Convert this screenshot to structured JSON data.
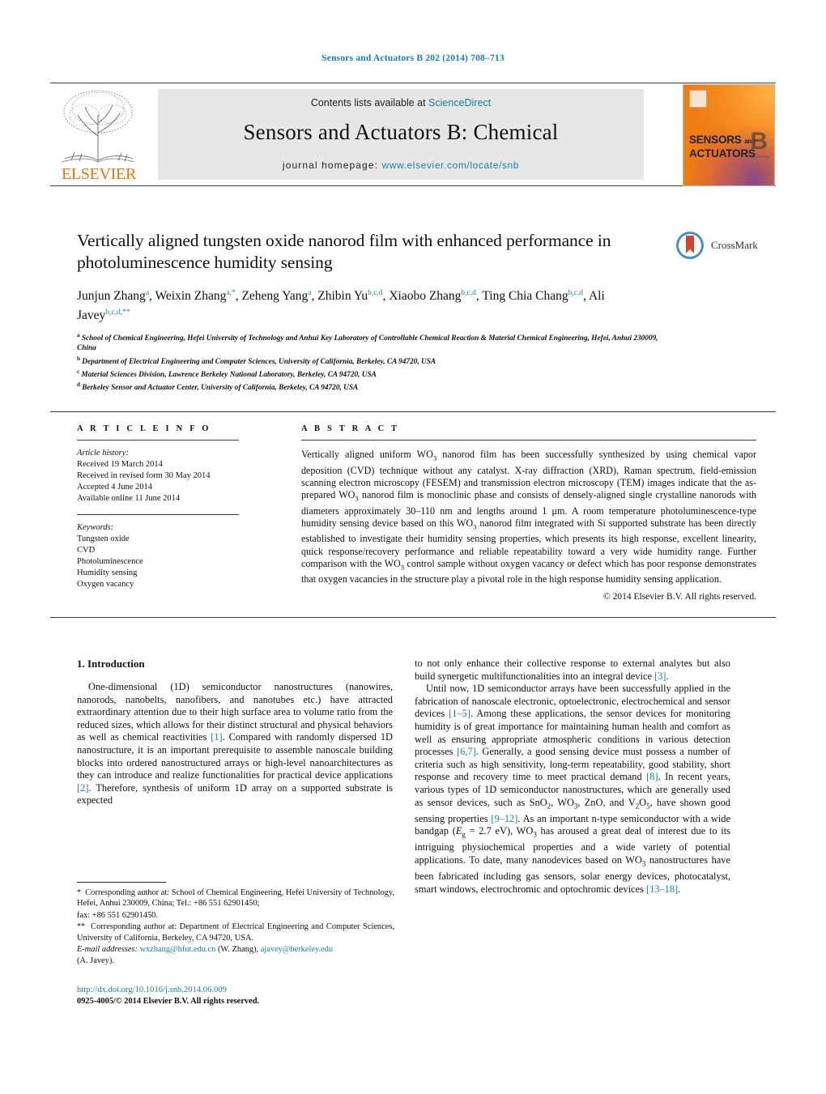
{
  "running_head": "Sensors and Actuators B 202 (2014) 708–713",
  "masthead": {
    "contents_prefix": "Contents lists available at ",
    "sciencedirect": "ScienceDirect",
    "journal_title": "Sensors and Actuators B: Chemical",
    "homepage_label": "journal homepage:",
    "homepage_url": "www.elsevier.com/locate/snb",
    "publisher_wordmark": "ELSEVIER",
    "cover": {
      "line1": "SENSORS",
      "line1_small": "and",
      "line2": "ACTUATORS",
      "volume_letter": "B",
      "volume_sub": "Chemical"
    }
  },
  "article": {
    "title": "Vertically aligned tungsten oxide nanorod film with enhanced performance in photoluminescence humidity sensing",
    "authors_html": "Junjun Zhang<sup>a</sup>, Weixin Zhang<sup>a,*</sup>, Zeheng Yang<sup>a</sup>, Zhibin Yu<sup>b,c,d</sup>, Xiaobo Zhang<sup>b,c,d</sup>, Ting Chia Chang<sup>b,c,d</sup>, Ali Javey<sup>b,c,d,**</sup>",
    "crossmark_label": "CrossMark",
    "affiliations": [
      "a School of Chemical Engineering, Hefei University of Technology and Anhui Key Laboratory of Controllable Chemical Reaction & Material Chemical Engineering, Hefei, Anhui 230009, China",
      "b Department of Electrical Engineering and Computer Sciences, University of California, Berkeley, CA 94720, USA",
      "c Material Sciences Division, Lawrence Berkeley National Laboratory, Berkeley, CA 94720, USA",
      "d Berkeley Sensor and Actuator Center, University of California, Berkeley, CA 94720, USA"
    ]
  },
  "article_info": {
    "heading": "A R T I C L E   I N F O",
    "history_label": "Article history:",
    "history": [
      "Received 19 March 2014",
      "Received in revised form 30 May 2014",
      "Accepted 4 June 2014",
      "Available online 11 June 2014"
    ],
    "keywords_label": "Keywords:",
    "keywords": [
      "Tungsten oxide",
      "CVD",
      "Photoluminescence",
      "Humidity sensing",
      "Oxygen vacancy"
    ]
  },
  "abstract": {
    "heading": "A B S T R A C T",
    "text_html": "Vertically aligned uniform WO<sub>3</sub> nanorod film has been successfully synthesized by using chemical vapor deposition (CVD) technique without any catalyst. X-ray diffraction (XRD), Raman spectrum, field-emission scanning electron microscopy (FESEM) and transmission electron microscopy (TEM) images indicate that the as-prepared WO<sub>3</sub> nanorod film is monoclinic phase and consists of densely-aligned single crystalline nanorods with diameters approximately 30–110 nm and lengths around 1 μm. A room temperature photoluminescence-type humidity sensing device based on this WO<sub>3</sub> nanorod film integrated with Si supported substrate has been directly established to investigate their humidity sensing properties, which presents its high response, excellent linearity, quick response/recovery performance and reliable repeatability toward a very wide humidity range. Further comparison with the WO<sub>3</sub> control sample without oxygen vacancy or defect which has poor response demonstrates that oxygen vacancies in the structure play a pivotal role in the high response humidity sensing application.",
    "copyright": "© 2014 Elsevier B.V. All rights reserved."
  },
  "body": {
    "section_heading": "1.  Introduction",
    "left_paragraphs_html": [
      "One-dimensional (1D) semiconductor nanostructures (nanowires, nanorods, nanobelts, nanofibers, and nanotubes etc.) have attracted extraordinary attention due to their high surface area to volume ratio from the reduced sizes, which allows for their distinct structural and physical behaviors as well as chemical reactivities <span class=\"cite\">[1]</span>. Compared with randomly dispersed 1D nanostructure, it is an important prerequisite to assemble nanoscale building blocks into ordered nanostructured arrays or high-level nanoarchitectures as they can introduce and realize functionalities for practical device applications <span class=\"cite\">[2]</span>. Therefore, synthesis of uniform 1D array on a supported substrate is expected"
    ],
    "right_paragraphs_html": [
      "to not only enhance their collective response to external analytes but also build synergetic multifunctionalities into an integral device <span class=\"cite\">[3]</span>.",
      "Until now, 1D semiconductor arrays have been successfully applied in the fabrication of nanoscale electronic, optoelectronic, electrochemical and sensor devices <span class=\"cite\">[1–5]</span>. Among these applications, the sensor devices for monitoring humidity is of great importance for maintaining human health and comfort as well as ensuring appropriate atmospheric conditions in various detection processes <span class=\"cite\">[6,7]</span>. Generally, a good sensing device must possess a number of criteria such as high sensitivity, long-term repeatability, good stability, short response and recovery time to meet practical demand <span class=\"cite\">[8]</span>. In recent years, various types of 1D semiconductor nanostructures, which are generally used as sensor devices, such as SnO<sub>2</sub>, WO<sub>3</sub>, ZnO, and V<sub>2</sub>O<sub>5</sub>, have shown good sensing properties <span class=\"cite\">[9–12]</span>. As an important n-type semiconductor with a wide bandgap (<i>E</i><sub>g</sub> = 2.7 eV), WO<sub>3</sub> has aroused a great deal of interest due to its intriguing physiochemical properties and a wide variety of potential applications. To date, many nanodevices based on WO<sub>3</sub> nanostructures have been fabricated including gas sensors, solar energy devices, photocatalyst, smart windows, electrochromic and optochromic devices <span class=\"cite\">[13–18]</span>."
    ]
  },
  "footnotes": {
    "corr1_html": "<span class=\"star\">*</span>&nbsp; Corresponding author at: School of Chemical Engineering, Hefei University of Technology, Hefei, Anhui 230009, China; Tel.: +86 551 62901450;",
    "corr1_fax_html": "fax: +86 551 62901450.",
    "corr2_html": "<span class=\"star\">**</span>&nbsp; Corresponding author at: Department of Electrical Engineering and Computer Sciences, University of California, Berkeley, CA 94720, USA.",
    "email_html": "<span class=\"em-label\">E-mail addresses:</span> <span class=\"link\">wxzhang@hfut.edu.cn</span> (W. Zhang), <span class=\"link\">ajavey@berkeley.edu</span>",
    "email_tail": "(A. Javey)."
  },
  "footer": {
    "doi": "http://dx.doi.org/10.1016/j.snb.2014.06.009",
    "issn_line": "0925-4005/© 2014 Elsevier B.V. All rights reserved."
  }
}
